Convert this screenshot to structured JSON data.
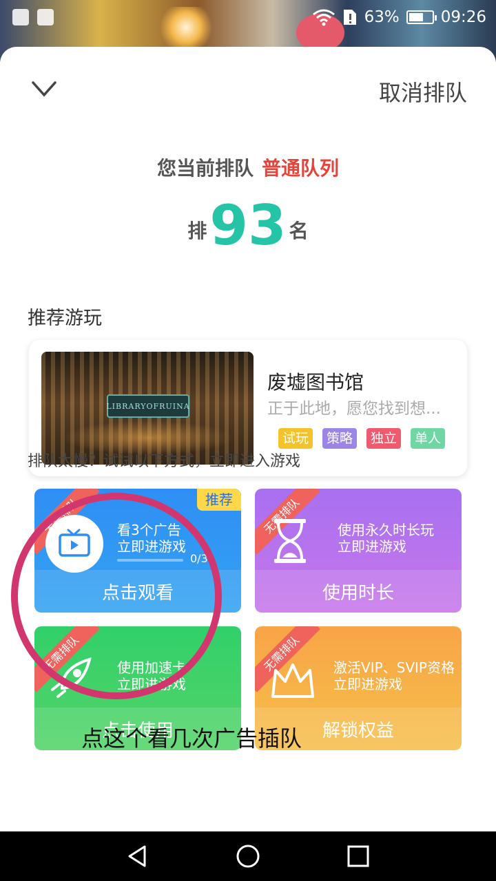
{
  "status_bar": {
    "battery": "63%",
    "battery_level": 0.63,
    "time": "09:26"
  },
  "header": {
    "cancel_label": "取消排队"
  },
  "queue": {
    "prefix": "您当前排队",
    "type": "普通队列",
    "rank_prefix": "排",
    "rank": "93",
    "rank_suffix": "名"
  },
  "recommend": {
    "title": "推荐游玩",
    "game": {
      "name": "废墟图书馆",
      "description": "正于此地，愿您找到想...",
      "thumb_logo": "LIBRARYOFRUINA",
      "tags": [
        {
          "label": "试玩",
          "color": "#f4c22a"
        },
        {
          "label": "策略",
          "color": "#9b86e6"
        },
        {
          "label": "独立",
          "color": "#ef5a6e"
        },
        {
          "label": "单人",
          "color": "#6fd6a4"
        }
      ]
    }
  },
  "tip": "排队太慢？试试以下方式，立即进入游戏",
  "options": {
    "corner_badge": "无需排队",
    "ad": {
      "recommend": "推荐",
      "line1": "看3个广告",
      "line2": "立即进游戏",
      "progress": "0/3",
      "progress_fraction": 0,
      "action": "点击观看"
    },
    "time": {
      "line1": "使用永久时长玩",
      "line2": "立即进游戏",
      "action": "使用时长"
    },
    "speed": {
      "line1": "使用加速卡",
      "line2": "立即进游戏",
      "action": "点击使用"
    },
    "vip": {
      "line1": "激活VIP、SVIP资格",
      "line2": "立即进游戏",
      "action": "解锁权益"
    }
  },
  "annotation": {
    "text": "点这个看几次广告插队",
    "color": "#d1366e"
  }
}
